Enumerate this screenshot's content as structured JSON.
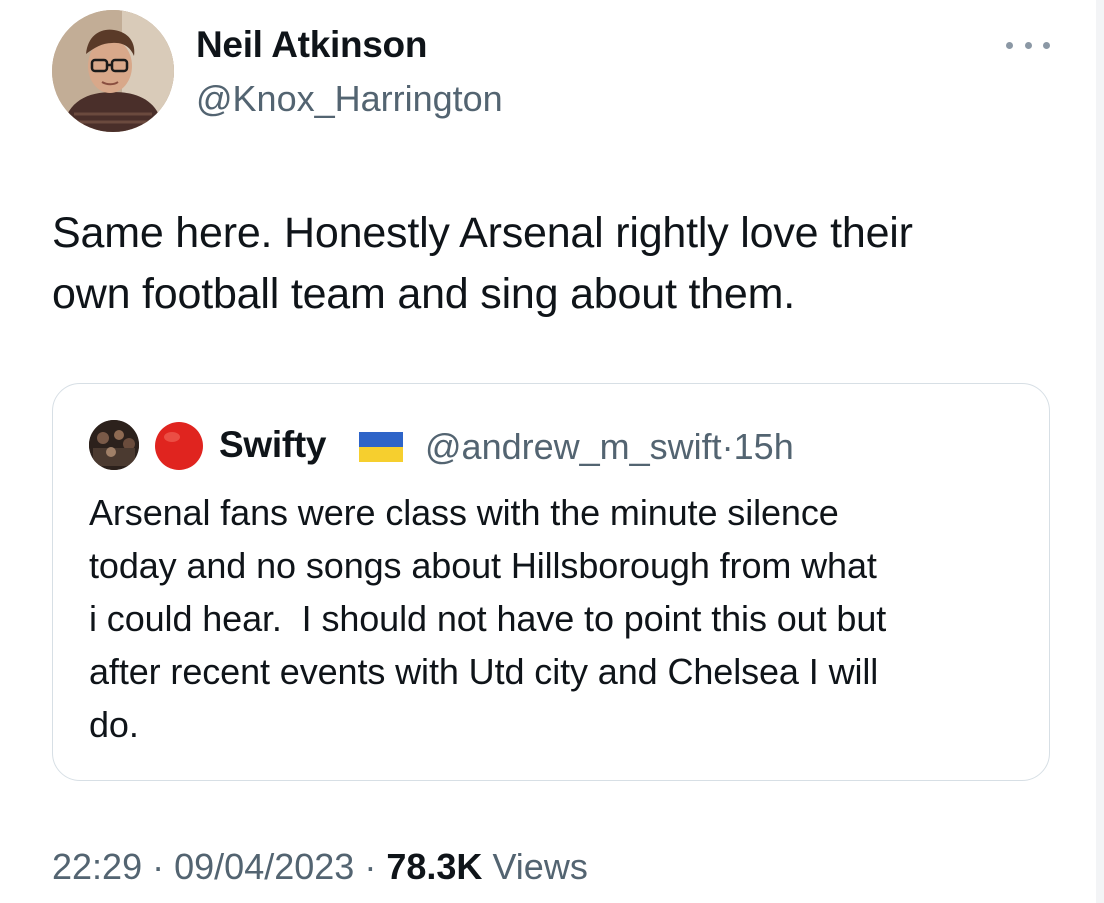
{
  "tweet": {
    "author": {
      "display_name": "Neil Atkinson",
      "handle": "@Knox_Harrington",
      "avatar": "profile-photo"
    },
    "more_icon": "more-horizontal-icon",
    "text_lines": [
      "Same here. Honestly Arsenal rightly love their",
      "own football team and sing about them."
    ],
    "quoted": {
      "avatar": "profile-photo",
      "badge": "red-circle-emoji",
      "display_name": "Swifty",
      "flag": "ukraine-flag-emoji",
      "handle": "@andrew_m_swift",
      "separator": "·",
      "time_ago": "15h",
      "text_lines": [
        "Arsenal fans were class with the minute silence",
        "today and no songs about Hillsborough from what",
        "i could hear.  I should not have to point this out but",
        "after recent events with Utd city and Chelsea I will",
        "do."
      ]
    },
    "meta": {
      "time": "22:29",
      "separator": "·",
      "date": "09/04/2023",
      "views_count": "78.3K",
      "views_label": "Views"
    }
  },
  "colors": {
    "text_primary": "#0f1419",
    "text_secondary": "#536471",
    "border": "#d7dfe5",
    "red_circle": "#e0241f",
    "flag_blue": "#2e64c8",
    "flag_yellow": "#f6cf2e"
  }
}
